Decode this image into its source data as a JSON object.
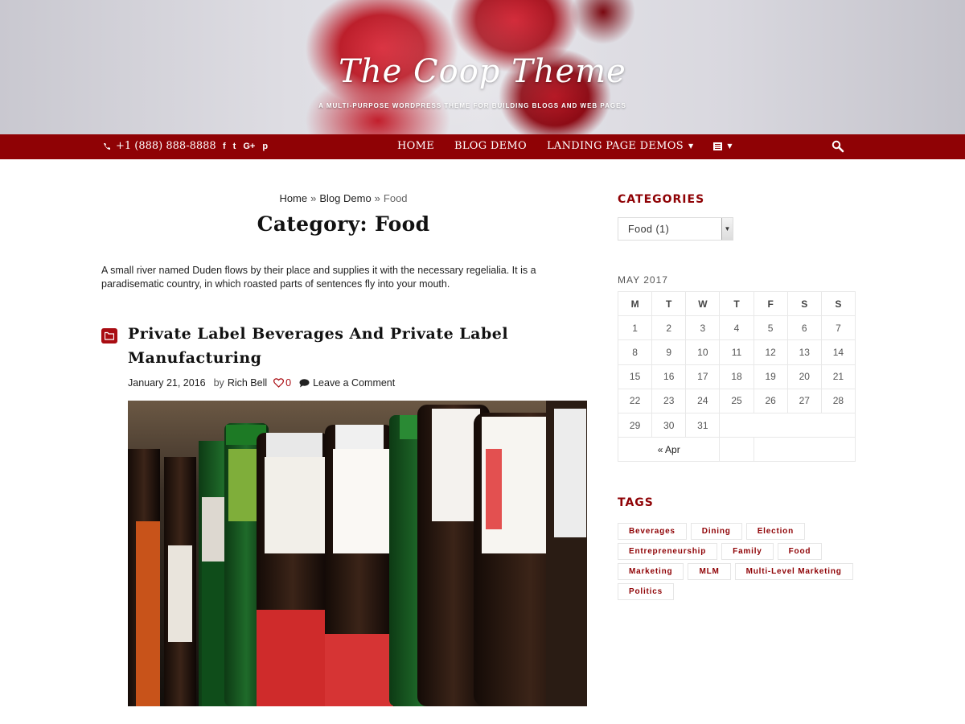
{
  "header": {
    "site_title": "The Coop Theme",
    "tagline": "A MULTI-PURPOSE WORDPRESS THEME FOR BUILDING BLOGS AND WEB PAGES"
  },
  "navbar": {
    "phone": "+1 (888) 888-8888",
    "social_icons": [
      "facebook-icon",
      "twitter-icon",
      "google-plus-icon",
      "pinterest-icon"
    ],
    "social_glyphs": [
      "f",
      "t",
      "G+",
      "p"
    ],
    "menu": [
      {
        "label": "HOME"
      },
      {
        "label": "BLOG DEMO"
      },
      {
        "label": "LANDING PAGE DEMOS"
      }
    ],
    "accent_color": "#8f0205"
  },
  "main": {
    "breadcrumb": {
      "home": "Home",
      "sep": "»",
      "blog": "Blog Demo",
      "current": "Food"
    },
    "page_title": "Category: Food",
    "category_description": "A small river named Duden flows by their place and supplies it with the necessary regelialia. It is a paradisematic country, in which roasted parts of sentences fly into your mouth.",
    "post": {
      "title": "Private Label Beverages And Private Label Manufacturing",
      "date": "January 21, 2016",
      "by_label": "by",
      "author": "Rich Bell",
      "likes": "0",
      "comments_label": "Leave a Comment"
    }
  },
  "sidebar": {
    "categories_heading": "CATEGORIES",
    "category_select_value": "Food  (1)",
    "calendar": {
      "caption": "MAY 2017",
      "weekdays": [
        "M",
        "T",
        "W",
        "T",
        "F",
        "S",
        "S"
      ],
      "weeks": [
        [
          "1",
          "2",
          "3",
          "4",
          "5",
          "6",
          "7"
        ],
        [
          "8",
          "9",
          "10",
          "11",
          "12",
          "13",
          "14"
        ],
        [
          "15",
          "16",
          "17",
          "18",
          "19",
          "20",
          "21"
        ],
        [
          "22",
          "23",
          "24",
          "25",
          "26",
          "27",
          "28"
        ],
        [
          "29",
          "30",
          "31",
          "",
          "",
          "",
          ""
        ]
      ],
      "prev_link": "« Apr"
    },
    "tags_heading": "TAGS",
    "tags": [
      "Beverages",
      "Dining",
      "Election",
      "Entrepreneurship",
      "Family",
      "Food",
      "Marketing",
      "MLM",
      "Multi-Level Marketing",
      "Politics"
    ]
  }
}
